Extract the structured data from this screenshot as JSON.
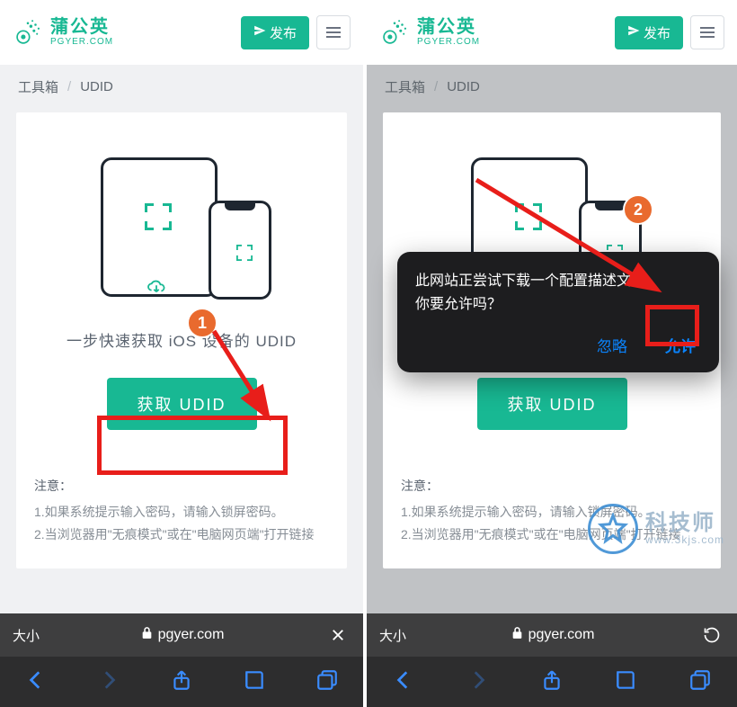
{
  "brand": {
    "name_cn": "蒲公英",
    "name_en": "PGYER.COM",
    "accent": "#18b893"
  },
  "header": {
    "publish_label": "发布",
    "menu_aria": "menu"
  },
  "breadcrumb": {
    "root": "工具箱",
    "sep": "/",
    "current": "UDID"
  },
  "card": {
    "tagline": "一步快速获取 iOS 设备的 UDID",
    "cta_label": "获取 UDID"
  },
  "notes": {
    "title": "注意：",
    "items": [
      "1.如果系统提示输入密码，请输入锁屏密码。",
      "2.当浏览器用\"无痕模式\"或在\"电脑网页端\"打开链接"
    ]
  },
  "safari": {
    "text_size_label": "大小",
    "url": "pgyer.com"
  },
  "annotations": {
    "step1": "1",
    "step2": "2"
  },
  "popup": {
    "line1": "此网站正尝试下载一个配置描述文件。",
    "line2": "你要允许吗？",
    "ignore_label": "忽略",
    "allow_label": "允许"
  },
  "watermark": {
    "title": "科技师",
    "sub": "www.3kjs.com"
  }
}
